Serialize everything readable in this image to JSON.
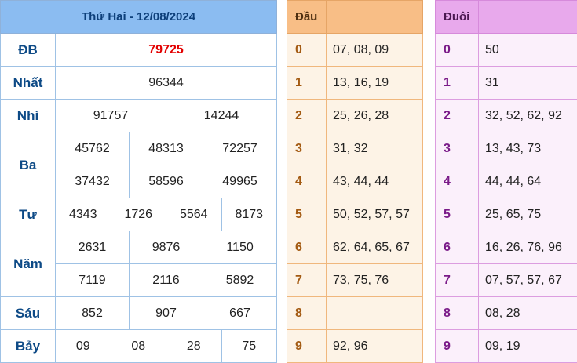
{
  "results": {
    "header": "Thứ Hai - 12/08/2024",
    "db": {
      "label": "ĐB",
      "value": "79725"
    },
    "nhat": {
      "label": "Nhất",
      "value": "96344"
    },
    "nhi": {
      "label": "Nhì",
      "values": [
        "91757",
        "14244"
      ]
    },
    "ba": {
      "label": "Ba",
      "values": [
        "45762",
        "48313",
        "72257",
        "37432",
        "58596",
        "49965"
      ]
    },
    "tu": {
      "label": "Tư",
      "values": [
        "4343",
        "1726",
        "5564",
        "8173"
      ]
    },
    "nam": {
      "label": "Năm",
      "values": [
        "2631",
        "9876",
        "1150",
        "7119",
        "2116",
        "5892"
      ]
    },
    "sau": {
      "label": "Sáu",
      "values": [
        "852",
        "907",
        "667"
      ]
    },
    "bay": {
      "label": "Bảy",
      "values": [
        "09",
        "08",
        "28",
        "75"
      ]
    }
  },
  "head": {
    "title": "Đầu",
    "rows": [
      {
        "key": "0",
        "val": "07, 08, 09"
      },
      {
        "key": "1",
        "val": "13, 16, 19"
      },
      {
        "key": "2",
        "val": "25, 26, 28"
      },
      {
        "key": "3",
        "val": "31, 32"
      },
      {
        "key": "4",
        "val": "43, 44, 44"
      },
      {
        "key": "5",
        "val": "50, 52, 57, 57"
      },
      {
        "key": "6",
        "val": "62, 64, 65, 67"
      },
      {
        "key": "7",
        "val": "73, 75, 76"
      },
      {
        "key": "8",
        "val": ""
      },
      {
        "key": "9",
        "val": "92, 96"
      }
    ]
  },
  "tail": {
    "title": "Đuôi",
    "rows": [
      {
        "key": "0",
        "val": "50"
      },
      {
        "key": "1",
        "val": "31"
      },
      {
        "key": "2",
        "val": "32, 52, 62, 92"
      },
      {
        "key": "3",
        "val": "13, 43, 73"
      },
      {
        "key": "4",
        "val": "44, 44, 64"
      },
      {
        "key": "5",
        "val": "25, 65, 75"
      },
      {
        "key": "6",
        "val": "16, 26, 76, 96"
      },
      {
        "key": "7",
        "val": "07, 57, 57, 67"
      },
      {
        "key": "8",
        "val": "08, 28"
      },
      {
        "key": "9",
        "val": "09, 19"
      }
    ]
  }
}
